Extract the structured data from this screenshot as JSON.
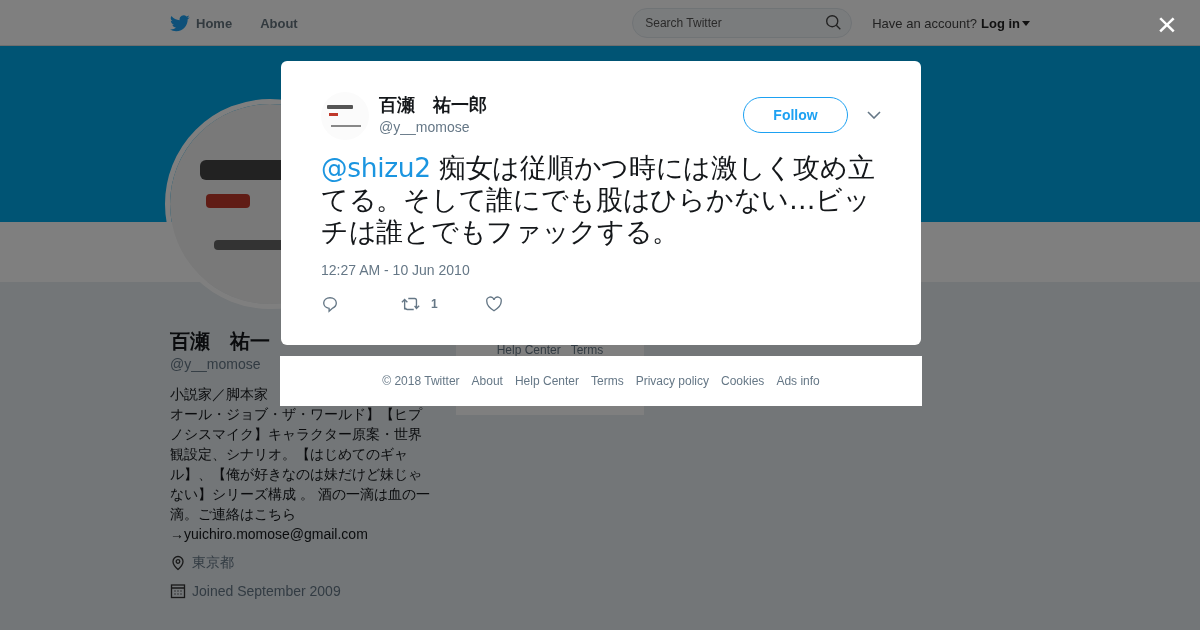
{
  "top_nav": {
    "items": [
      {
        "label": "Home",
        "kind": "home"
      },
      {
        "label": "About",
        "kind": "plain"
      }
    ],
    "search": {
      "placeholder": "Search Twitter"
    },
    "account_prompt": "Have an account?",
    "login": "Log in"
  },
  "close": "×",
  "profile": {
    "name": "百瀬　祐一",
    "handle": "@y__momose",
    "bio_lines": [
      "小説家／脚本家",
      "オール・ジョブ・ザ・ワールド】【ヒプ",
      "ノシスマイク】キャラクター原案・世界",
      "観設定、シナリオ。【はじめてのギャ",
      "ル】、【俺が好きなのは妹だけど妹じゃ",
      "ない】シリーズ構成 。 酒の一滴は血の一",
      "滴。ご連絡はこちら",
      "→yuichiro.momose@gmail.com"
    ],
    "location": "東京都",
    "joined": "Joined September 2009"
  },
  "page_footer": [
    "Help Center",
    "Terms"
  ],
  "tweet": {
    "name": "百瀬　祐一郎",
    "handle": "@y__momose",
    "follow": "Follow",
    "mention": "@shizu2",
    "text": " 痴女は従順かつ時には激しく攻め立てる。そして誰にでも股はひらかない…ビッチは誰とでもファックする。",
    "time": "12:27 AM - 10 Jun 2010",
    "retweets": "1"
  },
  "modal_footer": [
    "© 2018 Twitter",
    "About",
    "Help Center",
    "Terms",
    "Privacy policy",
    "Cookies",
    "Ads info"
  ]
}
